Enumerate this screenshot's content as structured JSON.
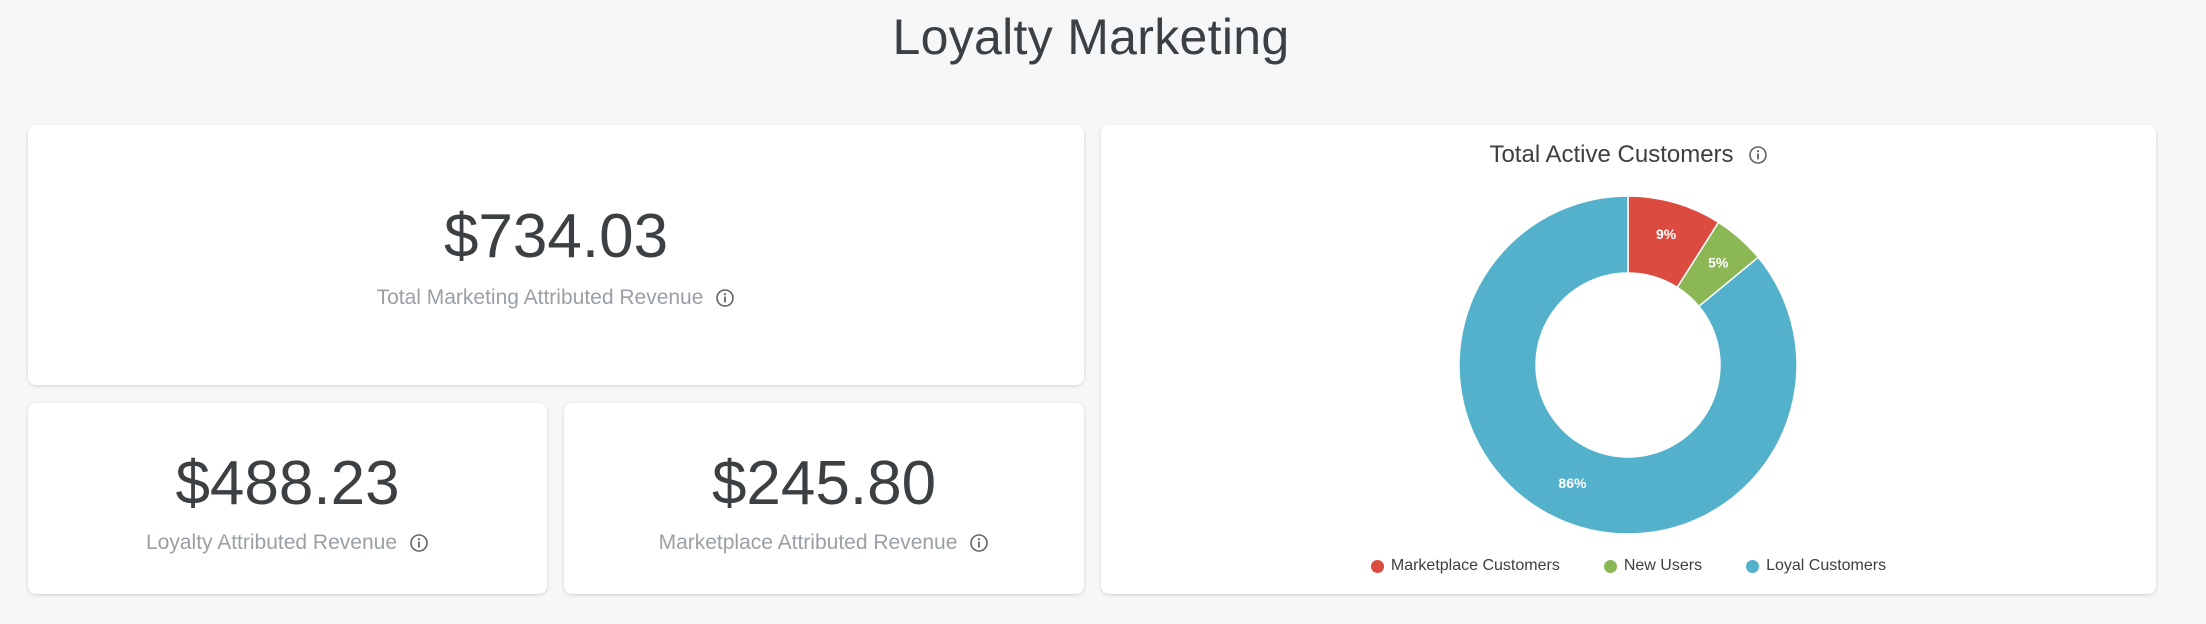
{
  "header": {
    "title": "Loyalty Marketing"
  },
  "metrics": {
    "total": {
      "value": "$734.03",
      "label": "Total Marketing Attributed Revenue"
    },
    "loyalty": {
      "value": "$488.23",
      "label": "Loyalty Attributed Revenue"
    },
    "marketplace": {
      "value": "$245.80",
      "label": "Marketplace Attributed Revenue"
    }
  },
  "icons": {
    "info": "info-icon"
  },
  "chart_data": {
    "type": "pie",
    "title": "Total Active Customers",
    "donut": true,
    "labels": [
      "Marketplace Customers",
      "New Users",
      "Loyal Customers"
    ],
    "values": [
      9,
      5,
      86
    ],
    "data_labels": [
      "9%",
      "5%",
      "86%"
    ],
    "colors": [
      "#db4b3f",
      "#8bb855",
      "#53b1cb"
    ],
    "legend": "bottom"
  }
}
